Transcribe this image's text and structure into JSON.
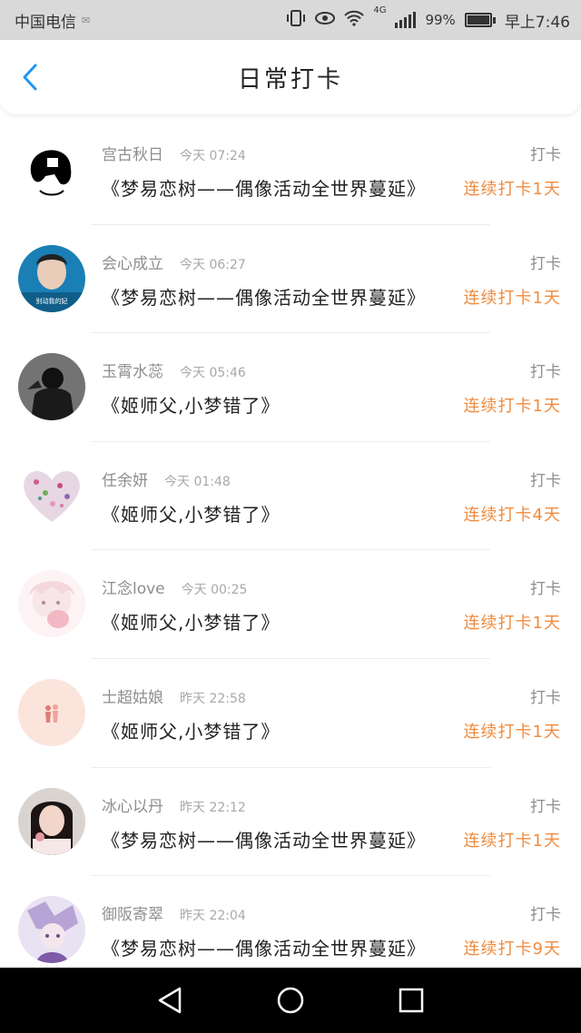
{
  "status_bar": {
    "carrier": "中国电信",
    "network": "4G",
    "battery": "99%",
    "time": "早上7:46"
  },
  "header": {
    "title": "日常打卡"
  },
  "list": [
    {
      "name": "宫古秋日",
      "time": "今天 07:24",
      "action": "打卡",
      "book": "《梦易恋树——偶像活动全世界蔓延》",
      "streak": "连续打卡1天",
      "avatar": "avatar-1"
    },
    {
      "name": "会心成立",
      "time": "今天 06:27",
      "action": "打卡",
      "book": "《梦易恋树——偶像活动全世界蔓延》",
      "streak": "连续打卡1天",
      "avatar": "avatar-2",
      "avatar_caption": "别动我的妃"
    },
    {
      "name": "玉霄水蕊",
      "time": "今天 05:46",
      "action": "打卡",
      "book": "《姬师父,小梦错了》",
      "streak": "连续打卡1天",
      "avatar": "avatar-3"
    },
    {
      "name": "任余妍",
      "time": "今天 01:48",
      "action": "打卡",
      "book": "《姬师父,小梦错了》",
      "streak": "连续打卡4天",
      "avatar": "avatar-4"
    },
    {
      "name": "江念love",
      "time": "今天 00:25",
      "action": "打卡",
      "book": "《姬师父,小梦错了》",
      "streak": "连续打卡1天",
      "avatar": "avatar-5"
    },
    {
      "name": "士超姑娘",
      "time": "昨天 22:58",
      "action": "打卡",
      "book": "《姬师父,小梦错了》",
      "streak": "连续打卡1天",
      "avatar": "avatar-6"
    },
    {
      "name": "冰心以丹",
      "time": "昨天 22:12",
      "action": "打卡",
      "book": "《梦易恋树——偶像活动全世界蔓延》",
      "streak": "连续打卡1天",
      "avatar": "avatar-7"
    },
    {
      "name": "御阪寄翠",
      "time": "昨天 22:04",
      "action": "打卡",
      "book": "《梦易恋树——偶像活动全世界蔓延》",
      "streak": "连续打卡9天",
      "avatar": "avatar-8"
    }
  ],
  "colors": {
    "accent": "#f08b3e",
    "back_arrow": "#2196f3",
    "status_bar": "#d9d9d9"
  },
  "icons": {
    "back": "back-arrow-icon",
    "nav_back": "triangle-back-icon",
    "nav_home": "circle-home-icon",
    "nav_recent": "square-recent-icon"
  }
}
